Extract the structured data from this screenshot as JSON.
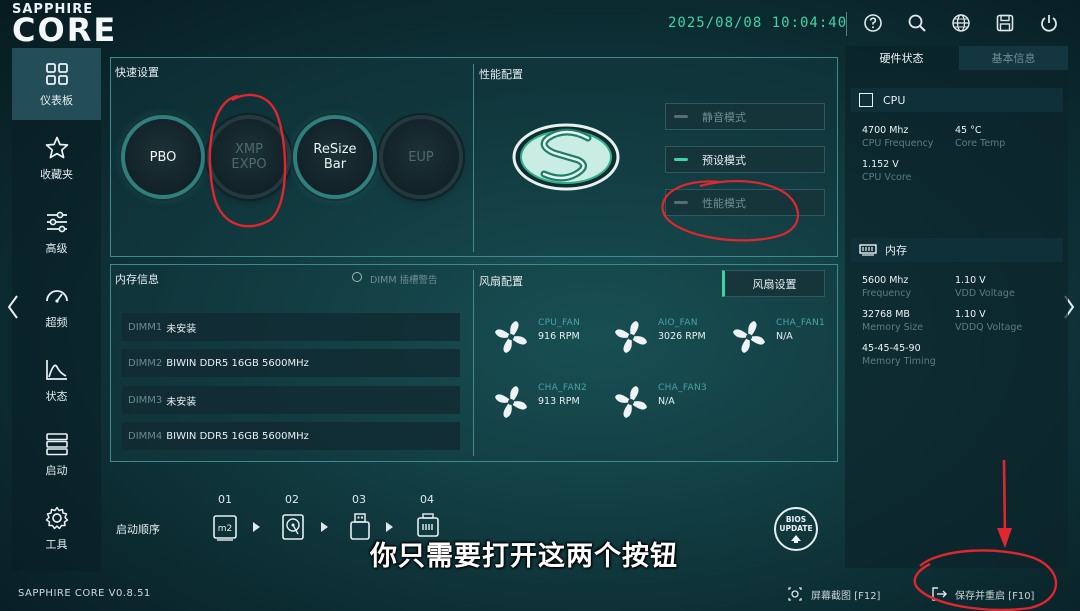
{
  "brand": {
    "line1": "SAPPHIRE",
    "line2": "CORE"
  },
  "header": {
    "datetime": "2025/08/08 10:04:40"
  },
  "toolbar": {
    "icons": [
      "help-icon",
      "search-icon",
      "globe-icon",
      "save-icon",
      "power-icon"
    ]
  },
  "nav": {
    "items": [
      {
        "label": "仪表板",
        "icon": "dashboard-icon",
        "active": true
      },
      {
        "label": "收藏夹",
        "icon": "star-icon"
      },
      {
        "label": "高级",
        "icon": "sliders-icon"
      },
      {
        "label": "超频",
        "icon": "gauge-icon"
      },
      {
        "label": "状态",
        "icon": "chart-icon"
      },
      {
        "label": "启动",
        "icon": "boot-list-icon"
      },
      {
        "label": "工具",
        "icon": "gear-icon"
      }
    ]
  },
  "quick_settings": {
    "title": "快速设置",
    "buttons": [
      {
        "label": "PBO",
        "state": "on"
      },
      {
        "label": "XMP\nEXPO",
        "state": "off"
      },
      {
        "label": "ReSize\nBar",
        "state": "on"
      },
      {
        "label": "EUP",
        "state": "off"
      }
    ]
  },
  "performance": {
    "title": "性能配置",
    "modes": [
      {
        "label": "静音模式",
        "active": false
      },
      {
        "label": "预设模式",
        "active": true
      },
      {
        "label": "性能模式",
        "active": false
      }
    ]
  },
  "memory": {
    "title": "内存信息",
    "warning": "DIMM 插槽警告",
    "slots": [
      {
        "slot": "DIMM1",
        "value": "未安装"
      },
      {
        "slot": "DIMM2",
        "value": "BIWIN DDR5 16GB 5600MHz"
      },
      {
        "slot": "DIMM3",
        "value": "未安装"
      },
      {
        "slot": "DIMM4",
        "value": "BIWIN DDR5 16GB 5600MHz"
      }
    ]
  },
  "fans": {
    "title": "风扇配置",
    "settings_button": "风扇设置",
    "items": [
      {
        "name": "CPU_FAN",
        "value": "916 RPM"
      },
      {
        "name": "AIO_FAN",
        "value": "3026 RPM"
      },
      {
        "name": "CHA_FAN1",
        "value": "N/A"
      },
      {
        "name": "CHA_FAN2",
        "value": "913 RPM"
      },
      {
        "name": "CHA_FAN3",
        "value": "N/A"
      }
    ]
  },
  "boot": {
    "title": "启动顺序",
    "numbers": [
      "01",
      "02",
      "03",
      "04"
    ],
    "devices": [
      "m2-drive-icon",
      "hdd-icon",
      "usb-icon",
      "network-icon"
    ],
    "bios_update": "BIOS\nUPDATE"
  },
  "hardware": {
    "tabs": [
      "硬件状态",
      "基本信息"
    ],
    "cpu": {
      "title": "CPU",
      "frequency": {
        "value": "4700 Mhz",
        "label": "CPU Frequency"
      },
      "temp": {
        "value": "45 °C",
        "label": "Core Temp"
      },
      "vcore": {
        "value": "1.152 V",
        "label": "CPU Vcore"
      }
    },
    "memory": {
      "title": "内存",
      "frequency": {
        "value": "5600 Mhz",
        "label": "Frequency"
      },
      "vdd": {
        "value": "1.10 V",
        "label": "VDD Voltage"
      },
      "size": {
        "value": "32768 MB",
        "label": "Memory Size"
      },
      "vddq": {
        "value": "1.10 V",
        "label": "VDDQ Voltage"
      },
      "timing": {
        "value": "45-45-45-90",
        "label": "Memory Timing"
      }
    }
  },
  "footer": {
    "version": "SAPPHIRE CORE V0.8.51",
    "screenshot": "屏幕截图 [F12]",
    "save_restart": "保存并重启 [F10]"
  },
  "subtitle": "你只需要打开这两个按钮",
  "colors": {
    "accent": "#3fd4a4",
    "annotation": "#e0262e",
    "panel_border": "#3e8a8f"
  }
}
